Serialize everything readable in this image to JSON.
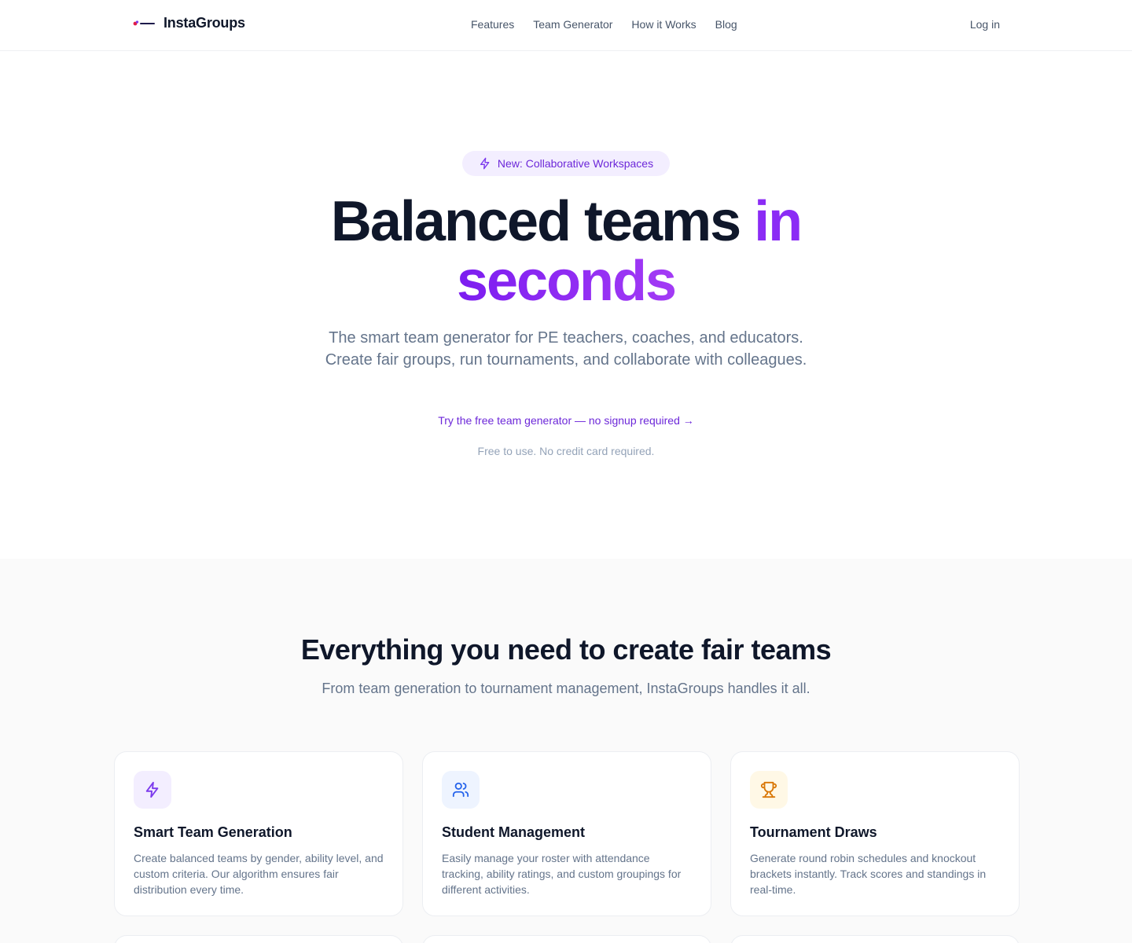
{
  "header": {
    "brand_name": "InstaGroups",
    "nav": [
      "Features",
      "Team Generator",
      "How it Works",
      "Blog"
    ],
    "login": "Log in"
  },
  "hero": {
    "badge": "New: Collaborative Workspaces",
    "title_main": "Balanced teams ",
    "title_accent_1": "in",
    "title_accent_2": "seconds",
    "subtitle_line1": "The smart team generator for PE teachers, coaches, and educators.",
    "subtitle_line2": "Create fair groups, run tournaments, and collaborate with colleagues.",
    "cta": "Try the free team generator — no signup required →",
    "note": "Free to use. No credit card required."
  },
  "features": {
    "title": "Everything you need to create fair teams",
    "subtitle": "From team generation to tournament management, InstaGroups handles it all.",
    "cards": [
      {
        "icon": "zap-icon",
        "title": "Smart Team Generation",
        "description": "Create balanced teams by gender, ability level, and custom criteria. Our algorithm ensures fair distribution every time."
      },
      {
        "icon": "users-icon",
        "title": "Student Management",
        "description": "Easily manage your roster with attendance tracking, ability ratings, and custom groupings for different activities."
      },
      {
        "icon": "trophy-icon",
        "title": "Tournament Draws",
        "description": "Generate round robin schedules and knockout brackets instantly. Track scores and standings in real-time."
      }
    ]
  },
  "colors": {
    "accent": "#7c3aed",
    "accent_badge_bg": "#f3eeff",
    "blue_icon": "#2563eb",
    "blue_icon_bg": "#eef4ff",
    "amber_icon": "#d97706",
    "amber_icon_bg": "#fff8e6"
  }
}
